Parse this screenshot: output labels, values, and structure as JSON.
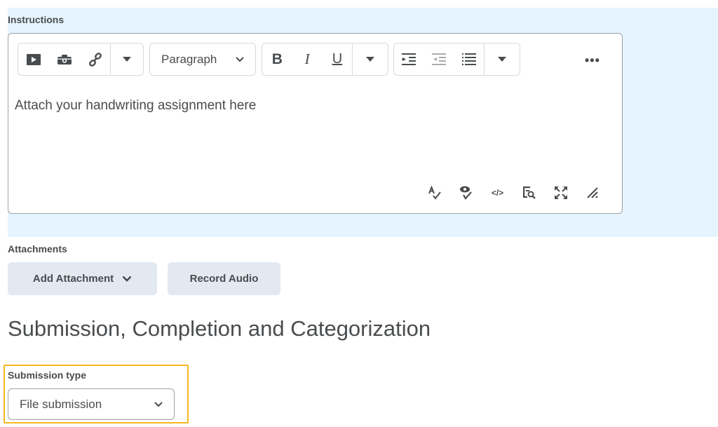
{
  "instructions": {
    "label": "Instructions",
    "toolbar": {
      "insert_group": [
        {
          "name": "insert-stuff",
          "icon": "play-icon"
        },
        {
          "name": "insert-image",
          "icon": "camera-icon"
        },
        {
          "name": "insert-link",
          "icon": "link-icon"
        }
      ],
      "block_format": "Paragraph",
      "format_group": [
        {
          "name": "bold",
          "glyph": "B"
        },
        {
          "name": "italic",
          "glyph": "I"
        },
        {
          "name": "underline",
          "glyph": "U"
        }
      ],
      "more_label": "•••"
    },
    "content": "Attach your handwriting assignment here",
    "bottom_tools": [
      {
        "name": "spellcheck",
        "icon": "spellcheck-icon"
      },
      {
        "name": "accessibility-check",
        "icon": "accessibility-check-icon"
      },
      {
        "name": "source-code",
        "icon": "source-code-icon",
        "glyph": "</>"
      },
      {
        "name": "preview",
        "icon": "preview-icon"
      },
      {
        "name": "fullscreen",
        "icon": "fullscreen-icon"
      },
      {
        "name": "resize",
        "icon": "resize-handle-icon"
      }
    ]
  },
  "attachments": {
    "label": "Attachments",
    "add_attachment_label": "Add Attachment",
    "record_audio_label": "Record Audio"
  },
  "section": {
    "title": "Submission, Completion and Categorization"
  },
  "submission_type": {
    "label": "Submission type",
    "selected": "File submission"
  },
  "colors": {
    "panel_bg": "#e5f4fe",
    "button_bg": "#e3e9f1",
    "highlight": "#f6b71f",
    "text": "#494c4e"
  }
}
